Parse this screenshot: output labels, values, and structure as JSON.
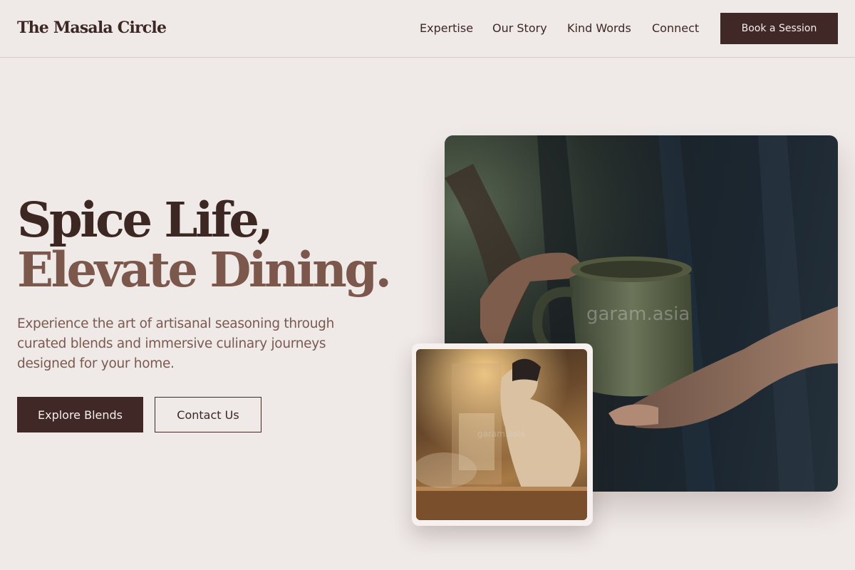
{
  "header": {
    "brand": "The Masala Circle",
    "nav": [
      "Expertise",
      "Our Story",
      "Kind Words",
      "Connect"
    ],
    "cta_label": "Book a Session"
  },
  "hero": {
    "headline_line1": "Spice Life,",
    "headline_line2": "Elevate Dining.",
    "lead": "Experience the art of artisanal seasoning through curated blends and immersive culinary journeys designed for your home.",
    "primary_button": "Explore Blends",
    "secondary_button": "Contact Us"
  },
  "images": {
    "main_watermark": "garam.asia",
    "inset_watermark": "garam.asia",
    "main_alt": "hands holding a green ceramic mug",
    "inset_alt": "chef cooking over a smoky stove"
  },
  "colors": {
    "background": "#efe9e7",
    "primary": "#3f2825",
    "accent_text": "#7b574c"
  }
}
